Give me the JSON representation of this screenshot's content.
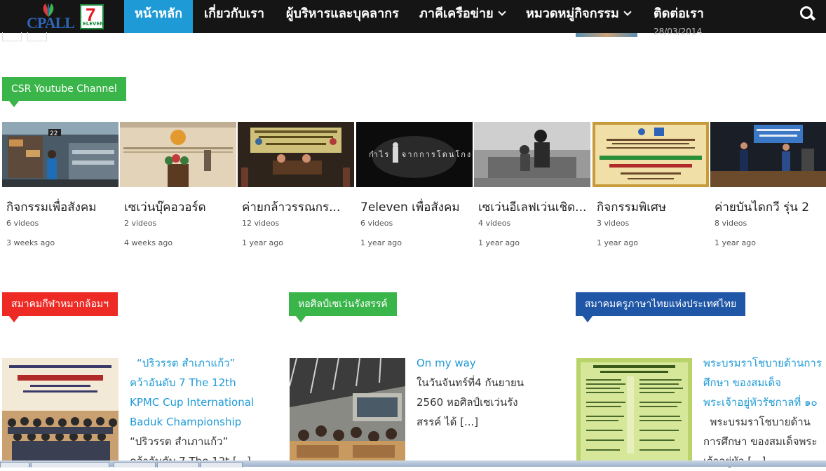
{
  "logo": {
    "text": "CPALL",
    "seven": "7",
    "eleven": "ELEVEN"
  },
  "nav": {
    "items": [
      {
        "label": "หน้าหลัก",
        "active": true
      },
      {
        "label": "เกี่ยวกับเรา"
      },
      {
        "label": "ผู้บริหารและบุคลากร"
      },
      {
        "label": "ภาคีเครือข่าย",
        "dropdown": true
      },
      {
        "label": "หมวดหมู่กิจกรรม",
        "dropdown": true
      },
      {
        "label": "ติดต่อเรา"
      }
    ],
    "search_icon": "search-icon"
  },
  "remnant_date": "28/03/2014",
  "youtube": {
    "label": "CSR Youtube Channel",
    "playlists": [
      {
        "title": "กิจกรรมเพื่อสังคม",
        "count": "6 videos",
        "ago": "3 weeks ago"
      },
      {
        "title": "เซเว่นบุ๊คอวอร์ด",
        "count": "2 videos",
        "ago": "4 weeks ago"
      },
      {
        "title": "ค่ายกล้าวรรณกร...",
        "count": "12 videos",
        "ago": "1 year ago"
      },
      {
        "title": "7eleven เพื่อสังคม",
        "count": "6 videos",
        "ago": "1 year ago",
        "overlay": "กำไร   จากการโดนโกง"
      },
      {
        "title": "เซเว่นอีเลฟเว่นเชิด...",
        "count": "4 videos",
        "ago": "1 year ago"
      },
      {
        "title": "กิจกรรมพิเศษ",
        "count": "3 videos",
        "ago": "1 year ago"
      },
      {
        "title": "ค่ายบันไดกวี รุ่น 2",
        "count": "8 videos",
        "ago": "1 year ago"
      }
    ]
  },
  "sections": [
    {
      "label": "สมาคมกีฬาหมากล้อมฯ",
      "color": "#ee2a24",
      "title_lines": [
        "“ปริวรรต  สำเภาแก้ว”",
        "คว้าอันดับ 7 The 12th",
        "KPMC Cup International",
        "Baduk Championship"
      ],
      "body_lines": [
        "“ปริวรรต  สำเภาแก้ว”",
        "คว้าอันดับ 7 The 12t [...]"
      ]
    },
    {
      "label": "หอศิลป์เซเว่นรังสรรค์",
      "color": "#3ab54a",
      "title_lines": [
        "On my way"
      ],
      "body_lines": [
        "ในวันจันทร์ที่4 กันยายน",
        "2560  หอศิลป์เซเว่นรัง",
        "สรรค์ ได้ [...]"
      ]
    },
    {
      "label": "สมาคมครูภาษาไทยแห่งประเทศไทย",
      "color": "#1f56a6",
      "title_lines": [
        "พระบรมราโชบายด้านการ",
        "ศึกษา ของสมเด็จ",
        "พระเจ้าอยู่หัวรัชกาลที่ ๑๐"
      ],
      "body_lines": [
        "  พระบรมราโชบายด้าน",
        "การศึกษา ของสมเด็จพระ",
        "เจ้าอยู่หัว [...]"
      ]
    }
  ],
  "colors": {
    "nav_bg": "#151515",
    "active": "#1e9ad6",
    "link": "#1e9ad6"
  }
}
